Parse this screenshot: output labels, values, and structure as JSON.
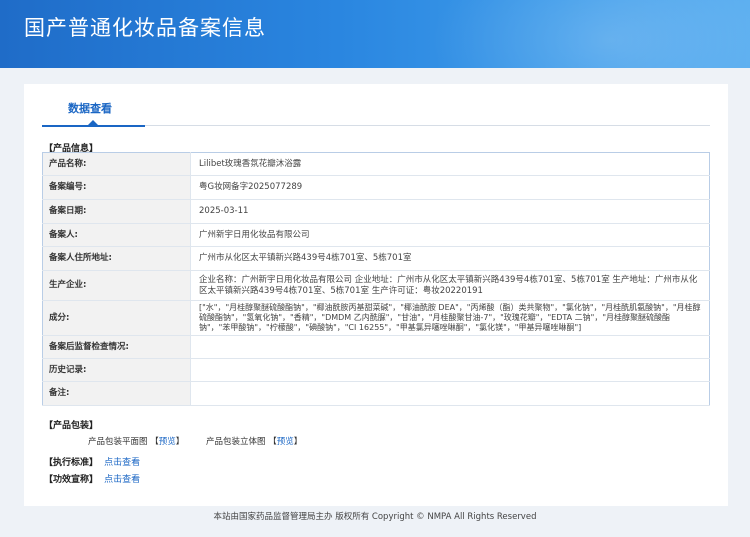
{
  "banner": {
    "title": "国产普通化妆品备案信息"
  },
  "tabs": [
    {
      "label": "数据查看"
    }
  ],
  "sections": {
    "product_info": "【产品信息】",
    "packaging": "【产品包装】",
    "standard": "【执行标准】",
    "efficacy": "【功效宣称】"
  },
  "product_info": {
    "rows": [
      {
        "label": "产品名称:",
        "value": "Lilibet玫瑰香氛花瓣沐浴露"
      },
      {
        "label": "备案编号:",
        "value": "粤G妆网备字2025077289"
      },
      {
        "label": "备案日期:",
        "value": "2025-03-11"
      },
      {
        "label": "备案人:",
        "value": "广州新宇日用化妆品有限公司"
      },
      {
        "label": "备案人住所地址:",
        "value": "广州市从化区太平镇新兴路439号4栋701室、5栋701室"
      },
      {
        "label": "生产企业:",
        "value": "企业名称：广州新宇日用化妆品有限公司 企业地址：广州市从化区太平镇新兴路439号4栋701室、5栋701室 生产地址：广州市从化区太平镇新兴路439号4栋701室、5栋701室 生产许可证：粤妆20220191"
      },
      {
        "label": "成分:",
        "value": "[\"水\"，\"月桂醇聚醚硫酸酯钠\"，\"椰油酰胺丙基甜菜碱\"，\"椰油酰胺 DEA\"，\"丙烯酸（酯）类共聚物\"，\"氯化钠\"，\"月桂酰肌氨酸钠\"，\"月桂醇硫酸酯钠\"，\"氢氧化钠\"，\"香精\"，\"DMDM 乙内酰脲\"，\"甘油\"，\"月桂酸聚甘油-7\"，\"玫瑰花瓣\"，\"EDTA 二钠\"，\"月桂醇聚醚硫酸酯钠\"，\"苯甲酸钠\"，\"柠檬酸\"，\"碘酸钠\"，\"CI 16255\"，\"甲基氯异噻唑啉酮\"，\"氯化镁\"，\"甲基异噻唑啉酮\"]"
      },
      {
        "label": "备案后监督检查情况:",
        "value": ""
      },
      {
        "label": "历史记录:",
        "value": ""
      },
      {
        "label": "备注:",
        "value": ""
      }
    ]
  },
  "packaging": {
    "flat_label": "产品包装平面图",
    "flat_link": "预览",
    "solid_label": "产品包装立体图",
    "solid_link": "预览",
    "bracket_open": "【",
    "bracket_close": "】"
  },
  "standard": {
    "link": "点击查看"
  },
  "efficacy": {
    "link": "点击查看"
  },
  "footer": {
    "text": "本站由国家药品监督管理局主办 版权所有 Copyright © NMPA All Rights Reserved"
  }
}
